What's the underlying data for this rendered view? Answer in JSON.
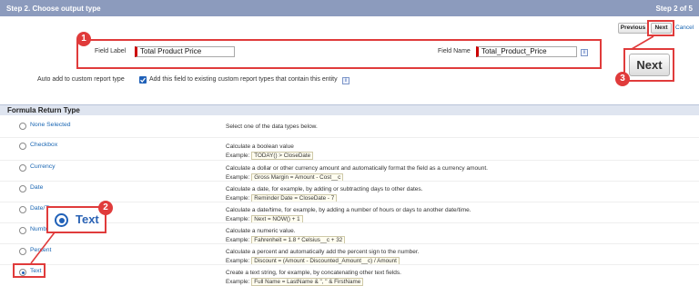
{
  "header": {
    "title": "Step 2. Choose output type",
    "step": "Step 2 of 5"
  },
  "fields": {
    "field_label_caption": "Field Label",
    "field_label_value": "Total Product Price",
    "field_name_caption": "Field Name",
    "field_name_value": "Total_Product_Price",
    "info_icon": "i"
  },
  "buttons": {
    "previous": "Previous",
    "next": "Next",
    "cancel": "Cancel",
    "big_next": "Next"
  },
  "auto_add": {
    "caption": "Auto add to custom report type",
    "checkbox_label": "Add this field to existing custom report types that contain this entity",
    "checked": true
  },
  "section": {
    "title": "Formula Return Type"
  },
  "annotations": {
    "one": "1",
    "two": "2",
    "three": "3",
    "zoom_label": "Text"
  },
  "types": [
    {
      "label": "None Selected",
      "desc": "Select one of the data types below.",
      "example_prefix": "",
      "example": ""
    },
    {
      "label": "Checkbox",
      "desc": "Calculate a boolean value",
      "example_prefix": "Example:",
      "example": "TODAY() > CloseDate"
    },
    {
      "label": "Currency",
      "desc": "Calculate a dollar or other currency amount and automatically format the field as a currency amount.",
      "example_prefix": "Example:",
      "example": "Gross Margin = Amount - Cost__c"
    },
    {
      "label": "Date",
      "desc": "Calculate a date, for example, by adding or subtracting days to other dates.",
      "example_prefix": "Example:",
      "example": "Reminder Date = CloseDate - 7"
    },
    {
      "label": "Date/Time",
      "desc": "Calculate a date/time, for example, by adding a number of hours or days to another date/time.",
      "example_prefix": "Example:",
      "example": "Next = NOW() + 1"
    },
    {
      "label": "Numbe",
      "desc": "Calculate a numeric value.",
      "example_prefix": "Example:",
      "example": "Fahrenheit = 1.8 * Celsius__c + 32"
    },
    {
      "label": "Percent",
      "desc": "Calculate a percent and automatically add the percent sign to the number.",
      "example_prefix": "Example:",
      "example": "Discount = (Amount - Discounted_Amount__c) / Amount"
    },
    {
      "label": "Text",
      "desc": "Create a text string, for example, by concatenating other text fields.",
      "example_prefix": "Example:",
      "example": "Full Name = LastName & \", \" & FirstName"
    }
  ],
  "selected_type": "Text",
  "colors": {
    "header": "#8c9bbd",
    "annotation": "#e03b3b",
    "link": "#1a66b3"
  }
}
